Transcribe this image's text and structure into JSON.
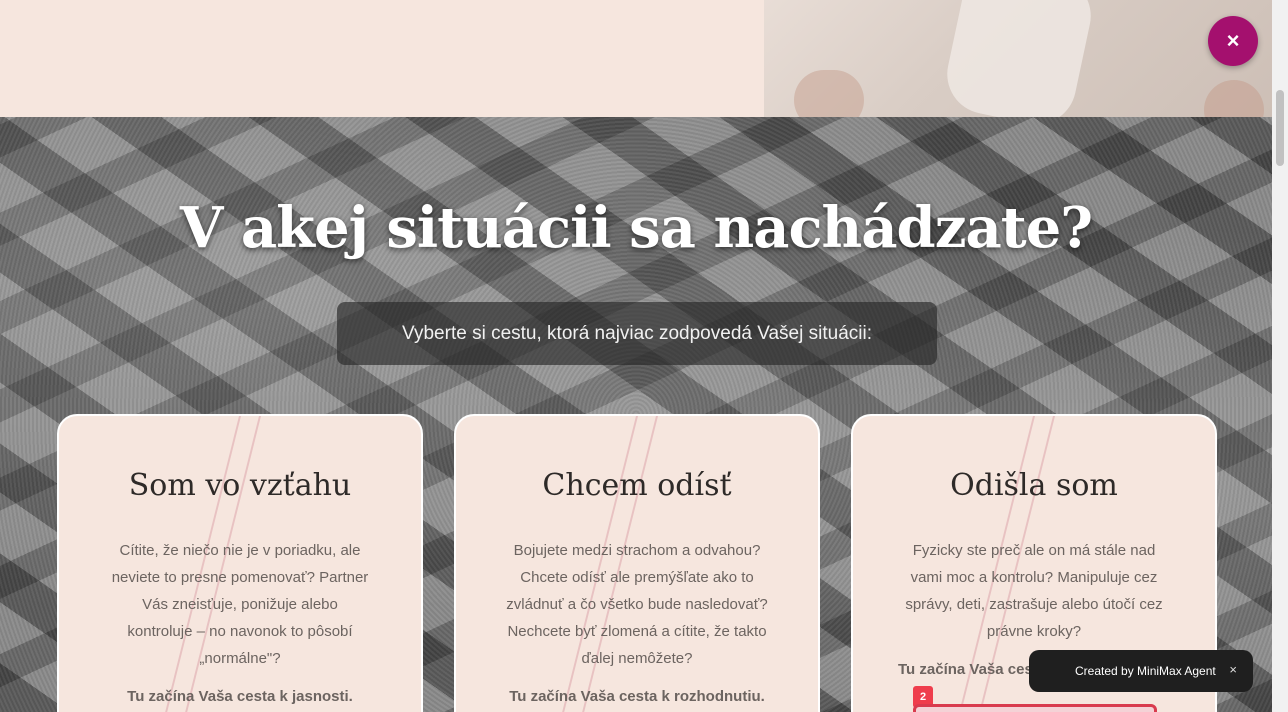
{
  "hero": {
    "title": "V akej situácii sa nachádzate?",
    "subtitle": "Vyberte si cestu, ktorá najviac zodpovedá Vašej situácii:"
  },
  "cards": [
    {
      "title": "Som vo vzťahu",
      "description": "Cítite, že niečo nie je v poriadku, ale neviete to presne pomenovať? Partner Vás zneisťuje, ponižuje alebo kontroluje – no navonok to pôsobí „normálne\"?",
      "cta": "Tu začína Vaša cesta k jasnosti."
    },
    {
      "title": "Chcem odísť",
      "description": "Bojujete medzi strachom a odvahou? Chcete odísť ale premýšľate ako to zvládnuť a čo všetko bude nasledovať? Nechcete byť zlomená a cítite, že takto ďalej nemôžete?",
      "cta": "Tu začína Vaša cesta k rozhodnutiu."
    },
    {
      "title": "Odišla som",
      "description": "Fyzicky ste preč ale on má stále nad vami moc a kontrolu? Manipuluje cez správy, deti, zastrašuje alebo útočí cez právne kroky?",
      "cta": "Tu začína Vaša cesta",
      "badge": "2"
    }
  ],
  "close_button": {
    "icon": "close-icon",
    "glyph": "×",
    "color": "#a4106e"
  },
  "toast": {
    "label": "Created by MiniMax Agent",
    "close_glyph": "×"
  },
  "colors": {
    "accent": "#a4106e",
    "card_bg": "#f6e6de",
    "badge": "#ef3d4c"
  }
}
